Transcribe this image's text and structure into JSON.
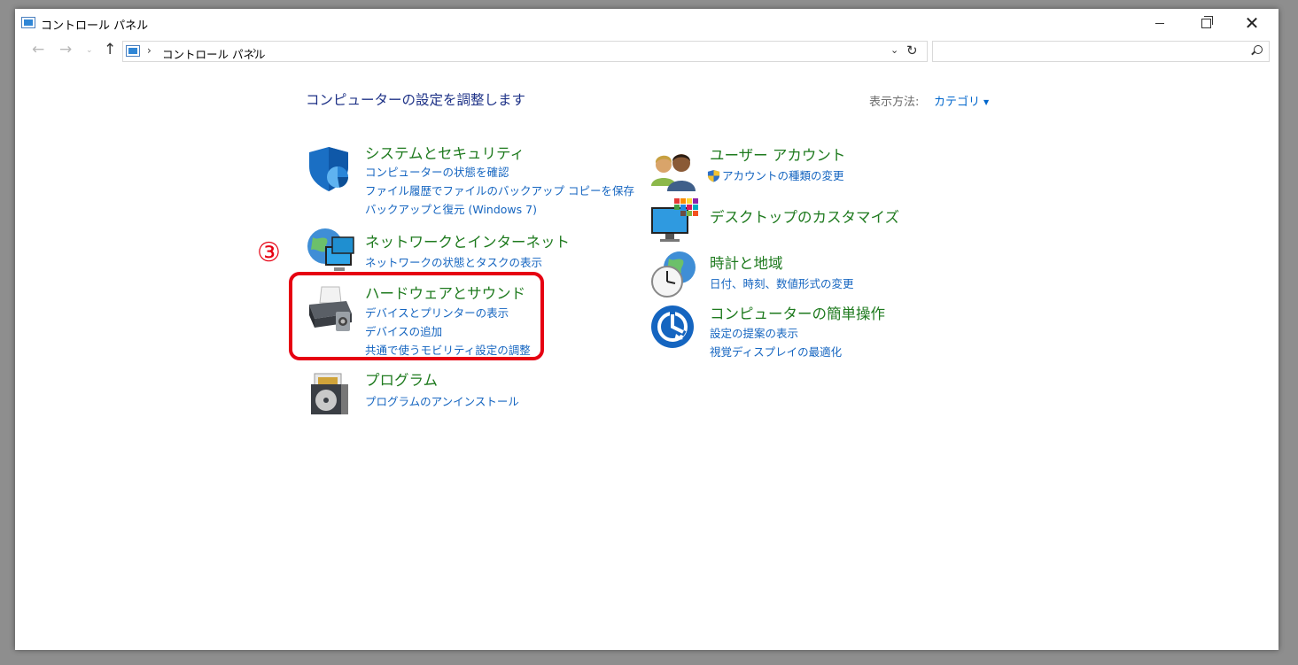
{
  "window": {
    "title": "コントロール パネル"
  },
  "nav": {
    "back": "←",
    "forward": "→",
    "recent": "⌄",
    "up": "↑",
    "breadcrumb": [
      "コントロール パネル"
    ],
    "refresh": "↻",
    "dropdown": "⌄"
  },
  "header": {
    "title": "コンピューターの設定を調整します",
    "view_label": "表示方法:",
    "view_value": "カテゴリ"
  },
  "left_categories": [
    {
      "title": "システムとセキュリティ",
      "links": [
        "コンピューターの状態を確認",
        "ファイル履歴でファイルのバックアップ コピーを保存",
        "バックアップと復元 (Windows 7)"
      ]
    },
    {
      "title": "ネットワークとインターネット",
      "links": [
        "ネットワークの状態とタスクの表示"
      ]
    },
    {
      "title": "ハードウェアとサウンド",
      "links": [
        "デバイスとプリンターの表示",
        "デバイスの追加",
        "共通で使うモビリティ設定の調整"
      ]
    },
    {
      "title": "プログラム",
      "links": [
        "プログラムのアンインストール"
      ]
    }
  ],
  "right_categories": [
    {
      "title": "ユーザー アカウント",
      "links": [
        "アカウントの種類の変更"
      ]
    },
    {
      "title": "デスクトップのカスタマイズ",
      "links": []
    },
    {
      "title": "時計と地域",
      "links": [
        "日付、時刻、数値形式の変更"
      ]
    },
    {
      "title": "コンピューターの簡単操作",
      "links": [
        "設定の提案の表示",
        "視覚ディスプレイの最適化"
      ]
    }
  ],
  "annotation": {
    "label": "③",
    "color": "#e60012"
  },
  "colors": {
    "title_green": "#1e7a1e",
    "link_blue": "#1565c0",
    "heading_blue": "#1e3287"
  }
}
